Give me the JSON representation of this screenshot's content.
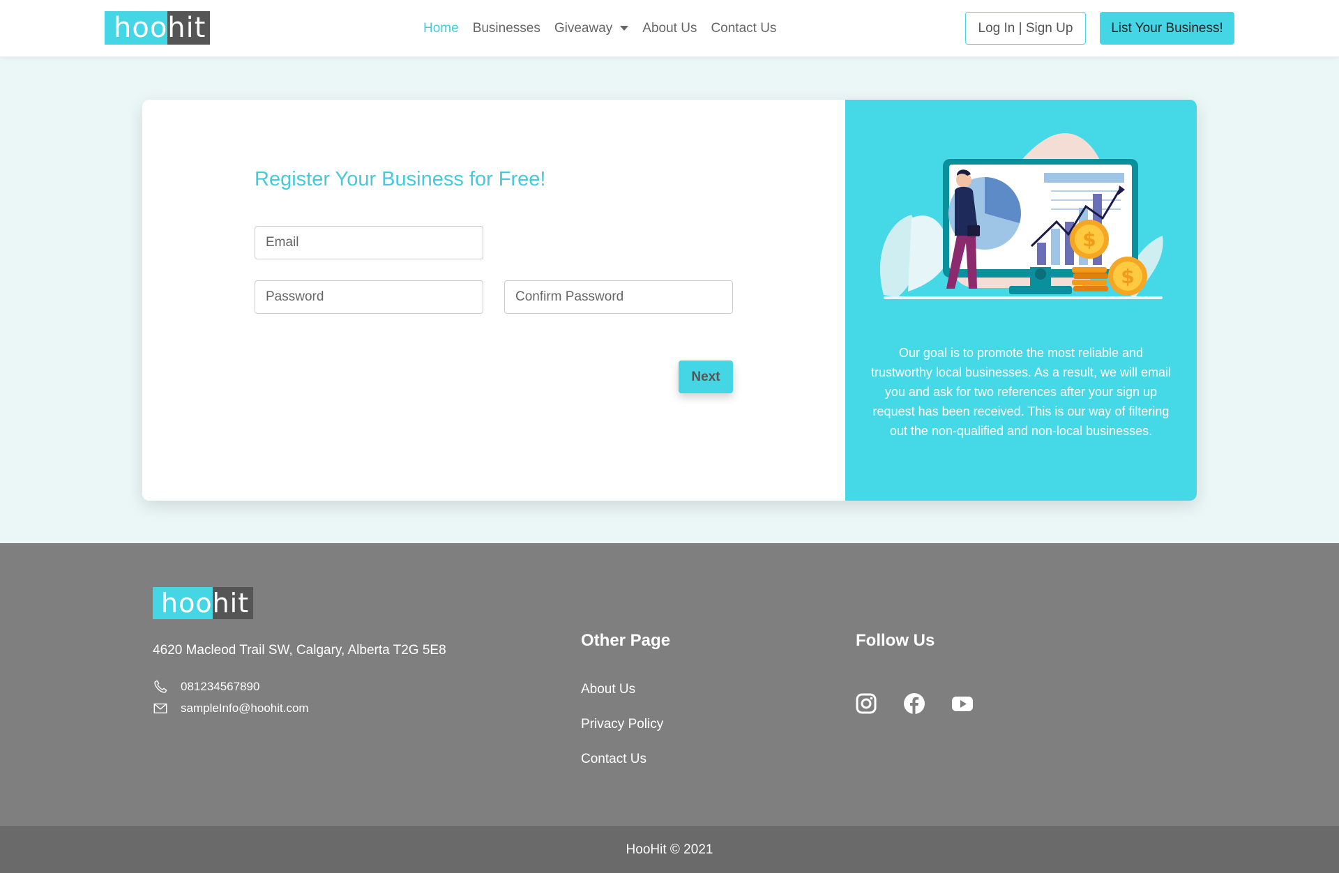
{
  "brand": {
    "logo_part1": "hoo",
    "logo_part2": "hit",
    "accent": "#45d6e6",
    "dark": "#555555"
  },
  "nav": {
    "items": [
      {
        "label": "Home",
        "active": true
      },
      {
        "label": "Businesses",
        "active": false
      },
      {
        "label": "Giveaway",
        "active": false,
        "dropdown": true
      },
      {
        "label": "About Us",
        "active": false
      },
      {
        "label": "Contact Us",
        "active": false
      }
    ],
    "login_label": "Log In | Sign Up",
    "list_label": "List Your Business!"
  },
  "form": {
    "title": "Register Your Business for Free!",
    "email_placeholder": "Email",
    "password_placeholder": "Password",
    "confirm_placeholder": "Confirm Password",
    "next_label": "Next"
  },
  "info": {
    "text": "Our goal is to promote the most reliable and trustworthy local businesses. As a result, we will email you and ask for two references after your sign up request has been received. This is our way of filtering out the non-qualified and non-local businesses."
  },
  "footer": {
    "address": "4620 Macleod Trail SW, Calgary, Alberta T2G 5E8",
    "phone": "081234567890",
    "email": "sampleInfo@hoohit.com",
    "other_page_heading": "Other Page",
    "links": [
      "About Us",
      "Privacy Policy",
      "Contact Us"
    ],
    "follow_heading": "Follow Us",
    "social": [
      "instagram-icon",
      "facebook-icon",
      "youtube-icon"
    ],
    "copyright": "HooHit © 2021"
  }
}
